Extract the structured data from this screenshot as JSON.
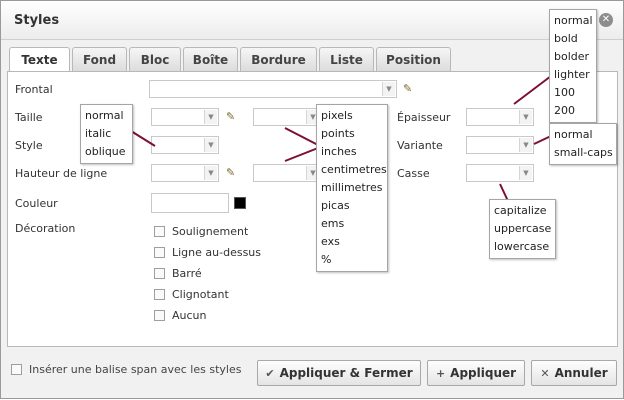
{
  "dialog": {
    "title": "Styles"
  },
  "tabs": [
    "Texte",
    "Fond",
    "Bloc",
    "Boîte",
    "Bordure",
    "Liste",
    "Position"
  ],
  "form": {
    "frontal": "Frontal",
    "taille": "Taille",
    "style": "Style",
    "hauteur": "Hauteur de ligne",
    "couleur": "Couleur",
    "decoration": "Décoration",
    "epaisseur": "Épaisseur",
    "variante": "Variante",
    "casse": "Casse"
  },
  "decorations": [
    "Soulignement",
    "Ligne au-dessus",
    "Barré",
    "Clignotant",
    "Aucun"
  ],
  "popups": {
    "font_style": [
      "normal",
      "italic",
      "oblique"
    ],
    "units": [
      "pixels",
      "points",
      "inches",
      "centimetres",
      "millimetres",
      "picas",
      "ems",
      "exs",
      "%"
    ],
    "weight": [
      "normal",
      "bold",
      "bolder",
      "lighter",
      "100",
      "200"
    ],
    "variant": [
      "normal",
      "small-caps"
    ],
    "case": [
      "capitalize",
      "uppercase",
      "lowercase"
    ]
  },
  "footer": {
    "span_checkbox": "Insérer une balise span avec les styles",
    "apply_close": "Appliquer & Fermer",
    "apply": "Appliquer",
    "cancel": "Annuler"
  },
  "icons": {
    "close": "close-icon",
    "pencil": "pencil-icon",
    "check": "check-icon",
    "plus": "plus-icon",
    "cross": "cross-icon",
    "dropdown": "chevron-down-icon"
  },
  "colors": {
    "connector": "#7b1032",
    "tab_active": "#ffffff",
    "panel_border": "#b8b8b8"
  }
}
